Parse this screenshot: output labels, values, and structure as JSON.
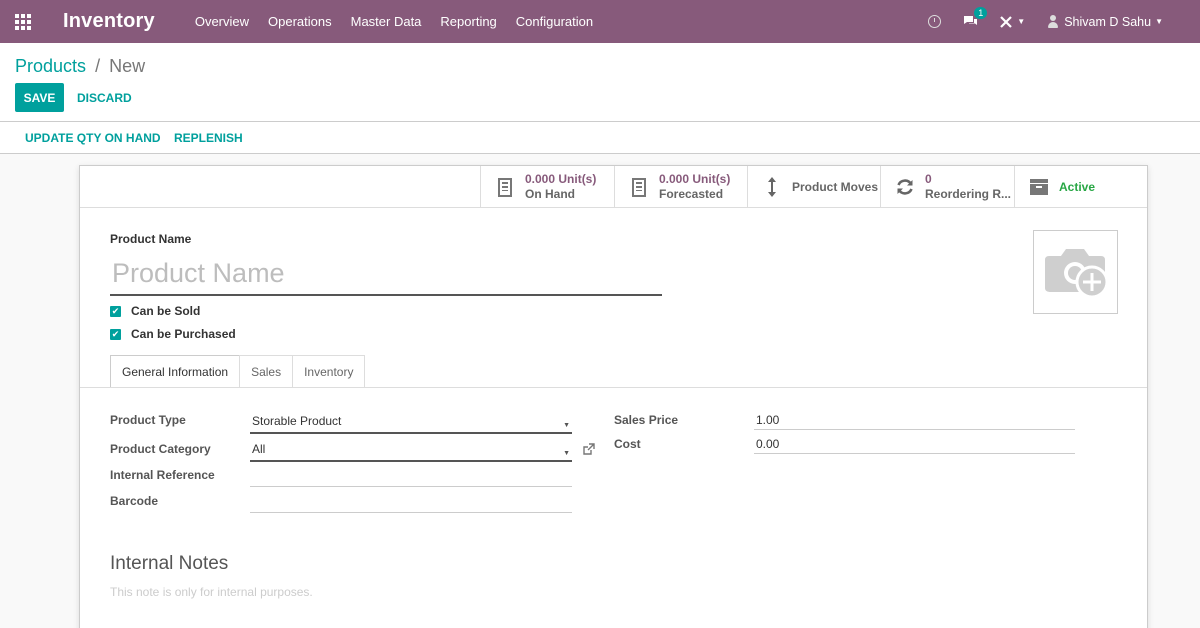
{
  "navbar": {
    "brand": "Inventory",
    "menu": [
      "Overview",
      "Operations",
      "Master Data",
      "Reporting",
      "Configuration"
    ],
    "messages_badge": "1",
    "user_name": "Shivam D Sahu",
    "bg_color": "#875a7b"
  },
  "control": {
    "breadcrumb_parent": "Products",
    "breadcrumb_sep": "/",
    "breadcrumb_current": "New",
    "save_label": "SAVE",
    "discard_label": "DISCARD"
  },
  "actions": {
    "update_qty": "UPDATE QTY ON HAND",
    "replenish": "REPLENISH"
  },
  "smart_buttons": {
    "on_hand_value": "0.000 Unit(s)",
    "on_hand_label": "On Hand",
    "forecasted_value": "0.000 Unit(s)",
    "forecasted_label": "Forecasted",
    "moves_label": "Product Moves",
    "reordering_value": "0",
    "reordering_label": "Reordering R...",
    "active_label": "Active"
  },
  "form": {
    "product_name_label": "Product Name",
    "product_name_placeholder": "Product Name",
    "can_be_sold": "Can be Sold",
    "can_be_purchased": "Can be Purchased",
    "tabs": [
      "General Information",
      "Sales",
      "Inventory"
    ],
    "product_type_label": "Product Type",
    "product_type_value": "Storable Product",
    "product_category_label": "Product Category",
    "product_category_value": "All",
    "internal_reference_label": "Internal Reference",
    "barcode_label": "Barcode",
    "sales_price_label": "Sales Price",
    "sales_price_value": "1.00",
    "cost_label": "Cost",
    "cost_value": "0.00",
    "notes_title": "Internal Notes",
    "notes_placeholder": "This note is only for internal purposes."
  },
  "colors": {
    "primary": "#00a09d",
    "brand": "#875a7b",
    "active_green": "#28a745"
  }
}
